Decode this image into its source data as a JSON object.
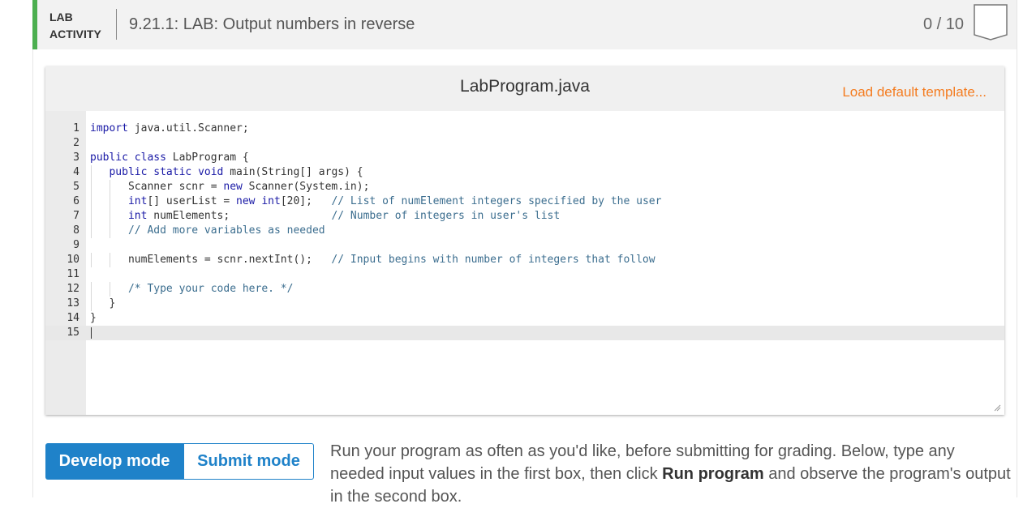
{
  "header": {
    "tag_line1": "LAB",
    "tag_line2": "ACTIVITY",
    "title": "9.21.1: LAB: Output numbers in reverse",
    "score": "0 / 10",
    "accent_color": "#4caf50"
  },
  "editor": {
    "file_name": "LabProgram.java",
    "load_template_label": "Load default template...",
    "lines": [
      {
        "n": "1",
        "t": "import java.util.Scanner;"
      },
      {
        "n": "2",
        "t": ""
      },
      {
        "n": "3",
        "t": "public class LabProgram {"
      },
      {
        "n": "4",
        "t": "   public static void main(String[] args) {"
      },
      {
        "n": "5",
        "t": "      Scanner scnr = new Scanner(System.in);"
      },
      {
        "n": "6",
        "t": "      int[] userList = new int[20];   // List of numElement integers specified by the user"
      },
      {
        "n": "7",
        "t": "      int numElements;                // Number of integers in user's list"
      },
      {
        "n": "8",
        "t": "      // Add more variables as needed"
      },
      {
        "n": "9",
        "t": ""
      },
      {
        "n": "10",
        "t": "      numElements = scnr.nextInt();   // Input begins with number of integers that follow"
      },
      {
        "n": "11",
        "t": ""
      },
      {
        "n": "12",
        "t": "      /* Type your code here. */"
      },
      {
        "n": "13",
        "t": "   }"
      },
      {
        "n": "14",
        "t": "}"
      },
      {
        "n": "15",
        "t": ""
      }
    ]
  },
  "modes": {
    "develop_label": "Develop mode",
    "submit_label": "Submit mode",
    "active_color": "#1f82c9"
  },
  "instructions": {
    "part1": "Run your program as often as you'd like, before submitting for grading. Below, type any needed input values in the first box, then click ",
    "bold": "Run program",
    "part2": " and observe the program's output in the second box."
  }
}
